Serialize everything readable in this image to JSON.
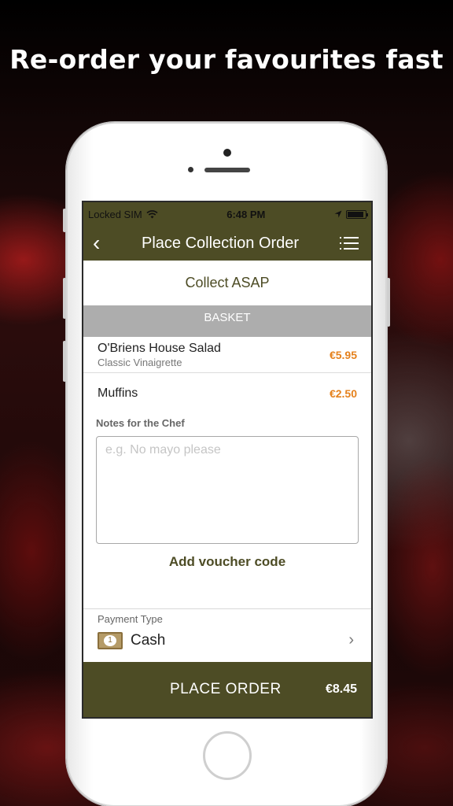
{
  "promo": {
    "headline": "Re-order your favourites fast"
  },
  "status_bar": {
    "carrier": "Locked SIM",
    "time": "6:48 PM"
  },
  "nav": {
    "back": "‹",
    "title": "Place Collection Order"
  },
  "collection": {
    "label": "Collect ASAP"
  },
  "basket": {
    "header": "BASKET",
    "items": [
      {
        "name": "O'Briens House Salad",
        "option": "Classic Vinaigrette",
        "price": "€5.95"
      },
      {
        "name": "Muffins",
        "price": "€2.50"
      }
    ]
  },
  "notes": {
    "label": "Notes for the Chef",
    "placeholder": "e.g. No mayo please"
  },
  "voucher": {
    "label": "Add voucher code"
  },
  "payment": {
    "label": "Payment Type",
    "method": "Cash",
    "icon": "cash-note-icon"
  },
  "order": {
    "button_label": "PLACE ORDER",
    "total": "€8.45"
  },
  "colors": {
    "brand": "#4d4c25",
    "price": "#e5811c",
    "basket_header": "#adadad"
  }
}
